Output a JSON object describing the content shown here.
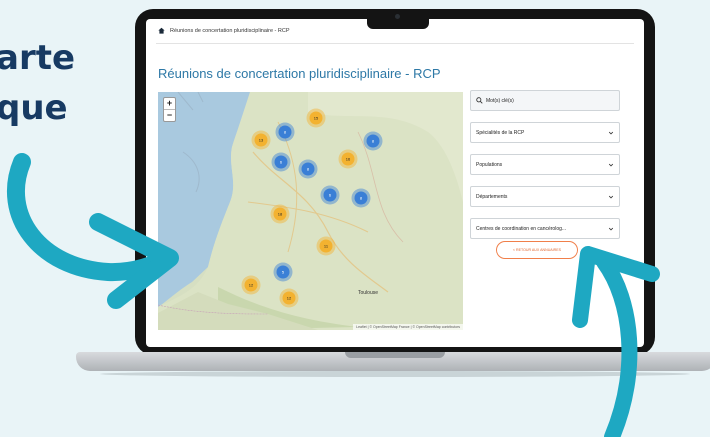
{
  "side_text": {
    "line1": "arte",
    "line2": "que"
  },
  "breadcrumb": {
    "text": "Réunions de concertation pluridisciplinaire - RCP"
  },
  "page": {
    "title": "Réunions de concertation pluridisciplinaire - RCP"
  },
  "map": {
    "zoom_in": "+",
    "zoom_out": "−",
    "attribution": "Leaflet | © OpenStreetMap France | © OpenStreetMap contributors",
    "labels": [
      "Toulouse"
    ],
    "markers": [
      {
        "value": "8",
        "color": "blue"
      },
      {
        "value": "15",
        "color": "orange"
      },
      {
        "value": "8",
        "color": "blue"
      },
      {
        "value": "13",
        "color": "orange"
      },
      {
        "value": "6",
        "color": "blue"
      },
      {
        "value": "8",
        "color": "blue"
      },
      {
        "value": "16",
        "color": "orange"
      },
      {
        "value": "6",
        "color": "blue"
      },
      {
        "value": "8",
        "color": "blue"
      },
      {
        "value": "18",
        "color": "orange"
      },
      {
        "value": "11",
        "color": "orange"
      },
      {
        "value": "5",
        "color": "blue"
      },
      {
        "value": "12",
        "color": "orange"
      },
      {
        "value": "12",
        "color": "orange"
      }
    ]
  },
  "filters": {
    "search_label": "Mot(s) clé(s)",
    "specialites": "Spécialités de la RCP",
    "populations": "Populations",
    "departements": "Départements",
    "centres": "Centres de coordination en cancérolog..."
  },
  "return_button": "< RETOUR AUX ANNUAIRES",
  "colors": {
    "title": "#2d78a6",
    "accent": "#e0662f",
    "arrow": "#1ea8c2",
    "heading": "#173a63"
  }
}
